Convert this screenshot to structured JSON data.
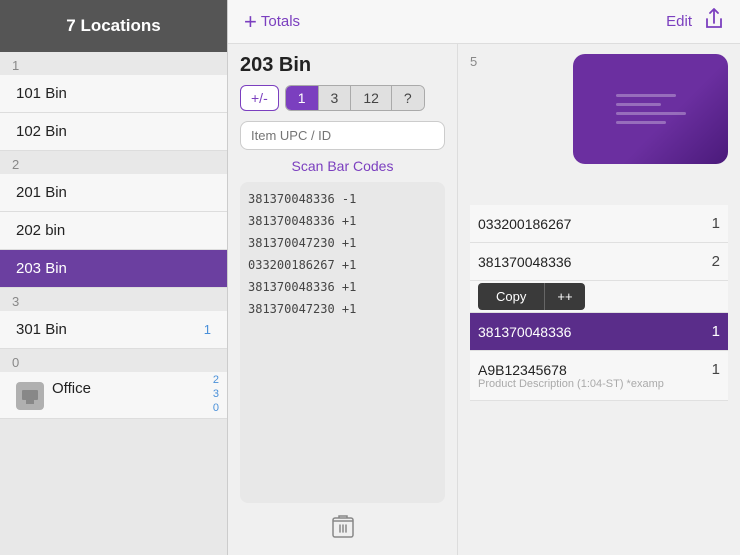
{
  "sidebar": {
    "header": "7 Locations",
    "groups": [
      {
        "label": "1",
        "items": [
          {
            "name": "101 Bin",
            "badge": ""
          },
          {
            "name": "102 Bin",
            "badge": ""
          }
        ]
      },
      {
        "label": "2",
        "items": [
          {
            "name": "201 Bin",
            "badge": ""
          },
          {
            "name": "202 bin",
            "badge": ""
          },
          {
            "name": "203 Bin",
            "badge": "",
            "active": true
          }
        ]
      },
      {
        "label": "3",
        "items": [
          {
            "name": "301 Bin",
            "badge": "1"
          }
        ]
      },
      {
        "label": "0",
        "items": [
          {
            "name": "Office",
            "badge": "0",
            "hasIcon": true,
            "badges": [
              "2",
              "3",
              "0"
            ]
          }
        ]
      }
    ]
  },
  "toolbar": {
    "add_label": "+",
    "totals_label": "Totals",
    "edit_label": "Edit",
    "share_icon": "⬆"
  },
  "left_panel": {
    "title": "203 Bin",
    "counter_pm": "+/-",
    "counter_tabs": [
      "1",
      "3",
      "12",
      "?"
    ],
    "active_tab": 0,
    "search_placeholder": "Item UPC / ID",
    "scan_codes_label": "Scan Bar Codes",
    "scan_items": [
      "381370048336  -1",
      "381370048336  +1",
      "381370047230  +1",
      "033200186267  +1",
      "381370048336  +1",
      "381370047230  +1"
    ],
    "delete_icon": "🗑"
  },
  "right_panel": {
    "count": "5",
    "items": [
      {
        "code": "033200186267",
        "count": "1",
        "desc": ""
      },
      {
        "code": "381370048336",
        "count": "2",
        "desc": "",
        "popup": true
      },
      {
        "code": "381370048336",
        "count": "1",
        "desc": "",
        "selected": true
      },
      {
        "code": "A9B12345678",
        "count": "1",
        "desc": "Product Description (1:04-ST) *examp"
      }
    ],
    "popup": {
      "copy_label": "Copy",
      "plus_label": "++"
    }
  }
}
